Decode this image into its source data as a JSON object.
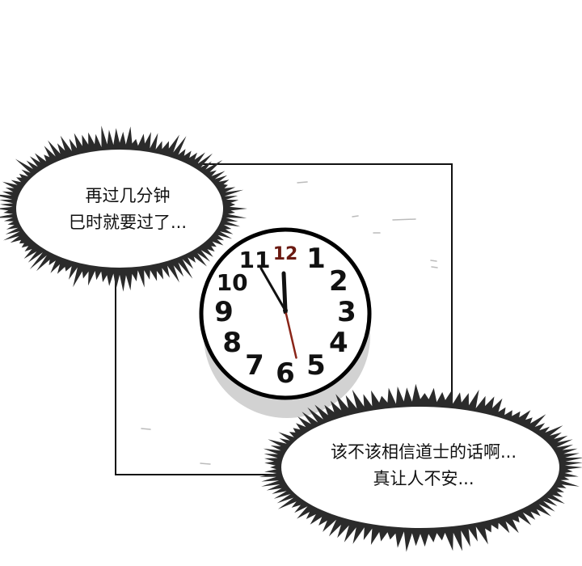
{
  "clock": {
    "numerals": [
      "12",
      "1",
      "2",
      "3",
      "4",
      "5",
      "6",
      "7",
      "8",
      "9",
      "10",
      "11"
    ],
    "accent_color": "#6b1a12",
    "hand_color": "#111111",
    "second_hand_color": "#8a2518",
    "time_shown": {
      "hour": 11,
      "minute": 55
    }
  },
  "bubbles": [
    {
      "lines": [
        "再过几分钟",
        "巳时就要过了..."
      ]
    },
    {
      "lines": [
        "该不该相信道士的话啊...",
        "真让人不安..."
      ]
    }
  ],
  "colors": {
    "bubble_fuzz": "#2b2b2b",
    "panel_border": "#111111",
    "shadow": "#cfcfcf"
  }
}
